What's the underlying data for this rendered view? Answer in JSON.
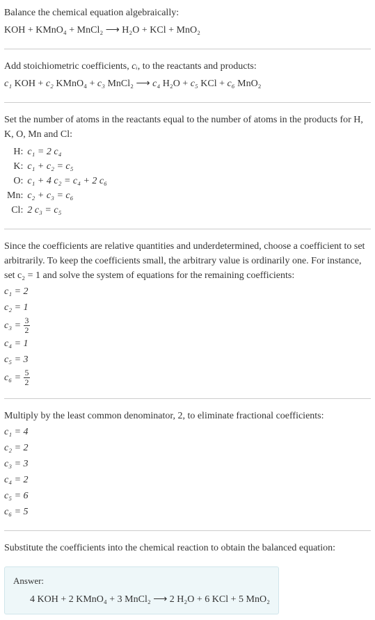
{
  "intro": {
    "line1": "Balance the chemical equation algebraically:",
    "equation": "KOH + KMnO₄ + MnCl₂ ⟶ H₂O + KCl + MnO₂"
  },
  "stoich": {
    "line1_a": "Add stoichiometric coefficients, ",
    "line1_b": ", to the reactants and products:",
    "ci": "cᵢ",
    "equation_parts": {
      "p1": " KOH + ",
      "p2": " KMnO₄ + ",
      "p3": " MnCl₂ ⟶ ",
      "p4": " H₂O + ",
      "p5": " KCl + ",
      "p6": " MnO₂"
    }
  },
  "atoms": {
    "line1": "Set the number of atoms in the reactants equal to the number of atoms in the products for H, K, O, Mn and Cl:",
    "rows": {
      "H_label": "H:",
      "H_eq": "c₁ = 2 c₄",
      "K_label": "K:",
      "K_eq": "c₁ + c₂ = c₅",
      "O_label": "O:",
      "O_eq": "c₁ + 4 c₂ = c₄ + 2 c₆",
      "Mn_label": "Mn:",
      "Mn_eq": "c₂ + c₃ = c₆",
      "Cl_label": "Cl:",
      "Cl_eq": "2 c₃ = c₅"
    }
  },
  "solve1": {
    "text": "Since the coefficients are relative quantities and underdetermined, choose a coefficient to set arbitrarily. To keep the coefficients small, the arbitrary value is ordinarily one. For instance, set c₂ = 1 and solve the system of equations for the remaining coefficients:",
    "c1": "c₁ = 2",
    "c2": "c₂ = 1",
    "c3_pre": "c₃ = ",
    "c3_num": "3",
    "c3_den": "2",
    "c4": "c₄ = 1",
    "c5": "c₅ = 3",
    "c6_pre": "c₆ = ",
    "c6_num": "5",
    "c6_den": "2"
  },
  "solve2": {
    "text": "Multiply by the least common denominator, 2, to eliminate fractional coefficients:",
    "c1": "c₁ = 4",
    "c2": "c₂ = 2",
    "c3": "c₃ = 3",
    "c4": "c₄ = 2",
    "c5": "c₅ = 6",
    "c6": "c₆ = 5"
  },
  "final": {
    "text": "Substitute the coefficients into the chemical reaction to obtain the balanced equation:"
  },
  "answer": {
    "label": "Answer:",
    "equation": "4 KOH + 2 KMnO₄ + 3 MnCl₂ ⟶ 2 H₂O + 6 KCl + 5 MnO₂"
  },
  "cvars": {
    "c1": "c₁",
    "c2": "c₂",
    "c3": "c₃",
    "c4": "c₄",
    "c5": "c₅",
    "c6": "c₆"
  }
}
